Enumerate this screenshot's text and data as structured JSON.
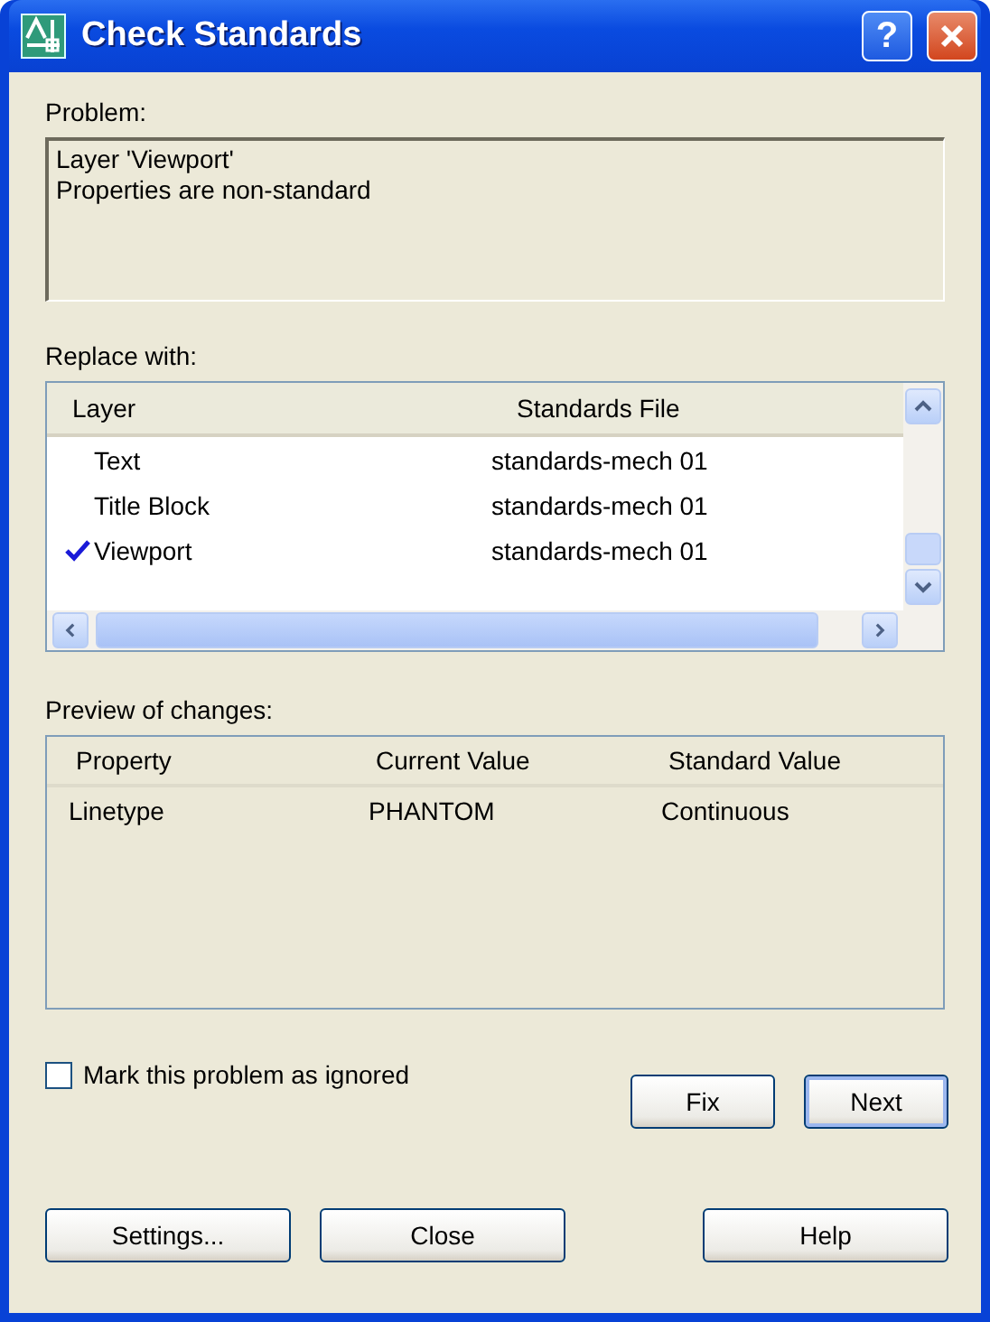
{
  "window": {
    "title": "Check Standards",
    "help_button": "?"
  },
  "problem": {
    "label": "Problem:",
    "lines": [
      "Layer 'Viewport'",
      "Properties are non-standard"
    ]
  },
  "replace_with": {
    "label": "Replace with:",
    "columns": [
      "Layer",
      "Standards File"
    ],
    "rows": [
      {
        "layer": "Text",
        "file": "standards-mech 01",
        "checked": false
      },
      {
        "layer": "Title Block",
        "file": "standards-mech 01",
        "checked": false
      },
      {
        "layer": "Viewport",
        "file": "standards-mech 01",
        "checked": true
      }
    ]
  },
  "preview": {
    "label": "Preview of changes:",
    "columns": [
      "Property",
      "Current Value",
      "Standard Value"
    ],
    "rows": [
      {
        "property": "Linetype",
        "current": "PHANTOM",
        "standard": "Continuous"
      }
    ]
  },
  "ignore_checkbox": {
    "label": "Mark this problem as ignored",
    "checked": false
  },
  "action_buttons": [
    "Fix",
    "Next"
  ],
  "footer_buttons": [
    "Settings...",
    "Close",
    "Help"
  ]
}
